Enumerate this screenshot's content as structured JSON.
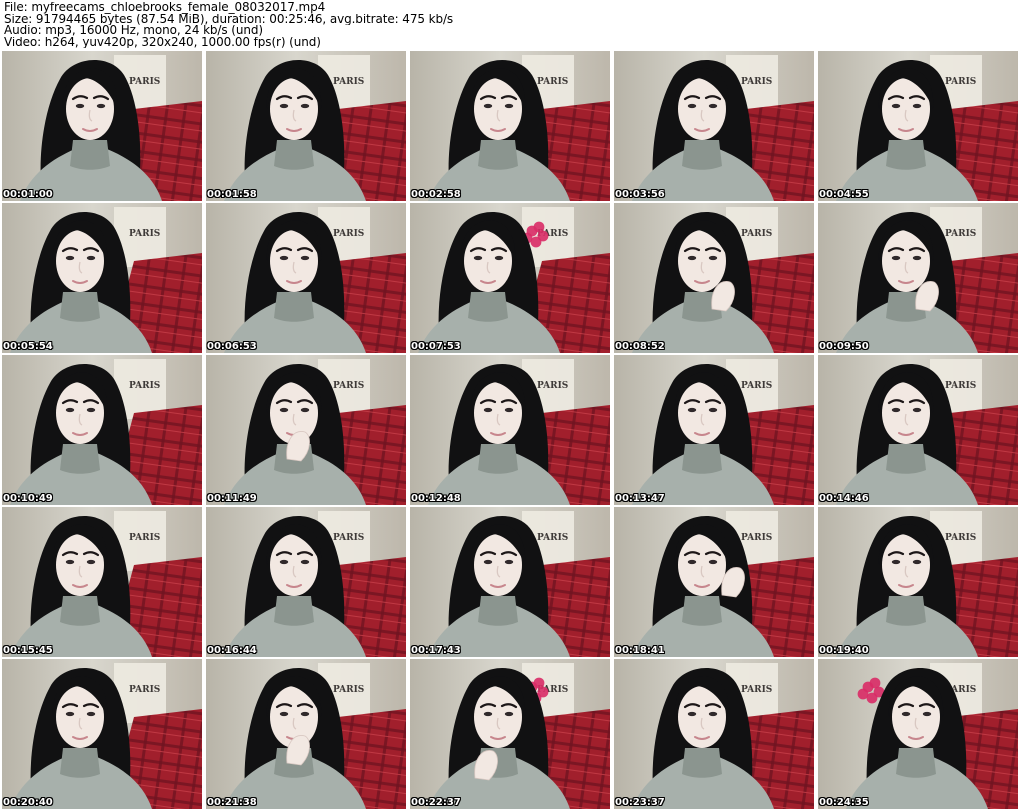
{
  "header": {
    "file_line": "File: myfreecams_chloebrooks_female_08032017.mp4",
    "size_line": "Size: 91794465 bytes (87.54 MiB), duration: 00:25:46, avg.bitrate: 475 kb/s",
    "audio_line": "Audio: mp3, 16000 Hz, mono, 24 kb/s (und)",
    "video_line": "Video: h264, yuv420p, 320x240, 1000.00 fps(r) (und)"
  },
  "thumbnails": [
    {
      "timestamp": "00:01:00",
      "pose": "center",
      "hand": "none",
      "flower": false
    },
    {
      "timestamp": "00:01:58",
      "pose": "center",
      "hand": "none",
      "flower": false
    },
    {
      "timestamp": "00:02:58",
      "pose": "center",
      "hand": "none",
      "flower": false
    },
    {
      "timestamp": "00:03:56",
      "pose": "center",
      "hand": "none",
      "flower": false
    },
    {
      "timestamp": "00:04:55",
      "pose": "center",
      "hand": "none",
      "flower": false
    },
    {
      "timestamp": "00:05:54",
      "pose": "left",
      "hand": "none",
      "flower": false
    },
    {
      "timestamp": "00:06:53",
      "pose": "center",
      "hand": "none",
      "flower": false
    },
    {
      "timestamp": "00:07:53",
      "pose": "left",
      "hand": "none",
      "flower": true
    },
    {
      "timestamp": "00:08:52",
      "pose": "center",
      "hand": "chin",
      "flower": false
    },
    {
      "timestamp": "00:09:50",
      "pose": "center",
      "hand": "chin",
      "flower": false
    },
    {
      "timestamp": "00:10:49",
      "pose": "left",
      "hand": "none",
      "flower": false
    },
    {
      "timestamp": "00:11:49",
      "pose": "center",
      "hand": "mouth",
      "flower": false
    },
    {
      "timestamp": "00:12:48",
      "pose": "center",
      "hand": "none",
      "flower": false
    },
    {
      "timestamp": "00:13:47",
      "pose": "center",
      "hand": "none",
      "flower": false
    },
    {
      "timestamp": "00:14:46",
      "pose": "center",
      "hand": "none",
      "flower": false
    },
    {
      "timestamp": "00:15:45",
      "pose": "left",
      "hand": "none",
      "flower": false
    },
    {
      "timestamp": "00:16:44",
      "pose": "center",
      "hand": "none",
      "flower": false
    },
    {
      "timestamp": "00:17:43",
      "pose": "center",
      "hand": "none",
      "flower": false
    },
    {
      "timestamp": "00:18:41",
      "pose": "center",
      "hand": "hair",
      "flower": false
    },
    {
      "timestamp": "00:19:40",
      "pose": "center",
      "hand": "none",
      "flower": false
    },
    {
      "timestamp": "00:20:40",
      "pose": "left",
      "hand": "none",
      "flower": false
    },
    {
      "timestamp": "00:21:38",
      "pose": "center",
      "hand": "mouth",
      "flower": false
    },
    {
      "timestamp": "00:22:37",
      "pose": "center",
      "hand": "neck",
      "flower": true
    },
    {
      "timestamp": "00:23:37",
      "pose": "center",
      "hand": "none",
      "flower": false
    },
    {
      "timestamp": "00:24:35",
      "pose": "right",
      "hand": "none",
      "flower": true
    }
  ],
  "colors": {
    "wall": "#d8d6cd",
    "wall_shadow": "#b8b4a8",
    "poster": "#ece9df",
    "poster_text": "#3e3a38",
    "blanket": "#a11f2c",
    "blanket_dark": "#6e1220",
    "blanket_light": "#c8404a",
    "hair": "#111112",
    "skin": "#f2e8e2",
    "skin_shadow": "#d9c8c2",
    "sweater": "#a7b0ab",
    "sweater_shadow": "#8b958f",
    "brow": "#1c1617",
    "lip": "#c7868d",
    "flower": "#d92b66"
  },
  "scene": {
    "poster_text": "PARIS"
  }
}
